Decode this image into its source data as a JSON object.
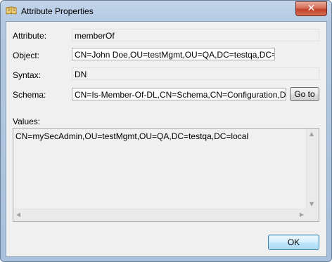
{
  "window": {
    "title": "Attribute Properties",
    "close_glyph": "✕",
    "app_icon": "book-icon"
  },
  "fields": {
    "attribute": {
      "label": "Attribute:",
      "value": "memberOf"
    },
    "object": {
      "label": "Object:",
      "value": "CN=John Doe,OU=testMgmt,OU=QA,DC=testqa,DC=local"
    },
    "syntax": {
      "label": "Syntax:",
      "value": "DN"
    },
    "schema": {
      "label": "Schema:",
      "value": "CN=Is-Member-Of-DL,CN=Schema,CN=Configuration,DC=testqa"
    }
  },
  "goto_button": {
    "label": "Go to"
  },
  "values": {
    "label": "Values:",
    "items": [
      "CN=mySecAdmin,OU=testMgmt,OU=QA,DC=testqa,DC=local"
    ]
  },
  "ok_button": {
    "label": "OK"
  },
  "colors": {
    "frame": "#b3c9e3",
    "client_bg": "#f0f0f0",
    "close_red": "#c0402a",
    "ok_border": "#3c7fb1"
  }
}
